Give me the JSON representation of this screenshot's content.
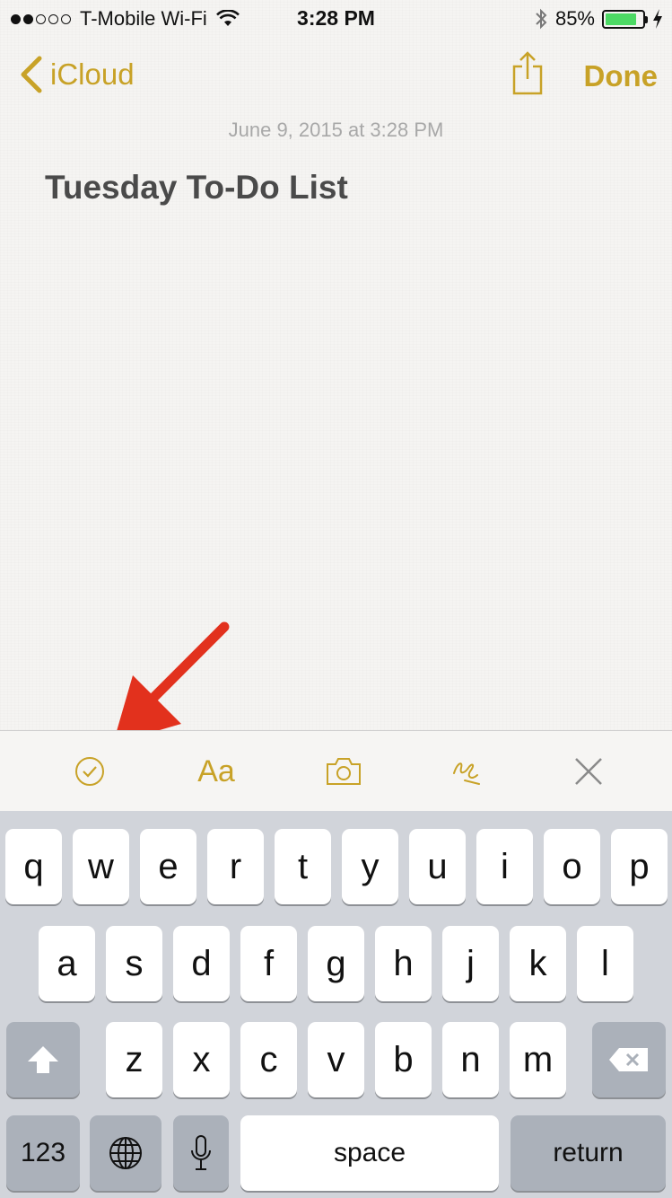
{
  "status_bar": {
    "signal_dots": [
      true,
      true,
      false,
      false,
      false
    ],
    "carrier": "T-Mobile Wi-Fi",
    "time": "3:28 PM",
    "battery_percent": "85%",
    "battery_level": 0.85
  },
  "nav": {
    "back_label": "iCloud",
    "done_label": "Done"
  },
  "note": {
    "date": "June 9, 2015 at 3:28 PM",
    "title": "Tuesday To-Do List"
  },
  "toolbar": {
    "format_label": "Aa",
    "icons": [
      "checklist-icon",
      "format-icon",
      "camera-icon",
      "sketch-icon",
      "close-icon"
    ]
  },
  "keyboard": {
    "row1": [
      "q",
      "w",
      "e",
      "r",
      "t",
      "y",
      "u",
      "i",
      "o",
      "p"
    ],
    "row2": [
      "a",
      "s",
      "d",
      "f",
      "g",
      "h",
      "j",
      "k",
      "l"
    ],
    "row3": [
      "z",
      "x",
      "c",
      "v",
      "b",
      "n",
      "m"
    ],
    "numbers_label": "123",
    "space_label": "space",
    "return_label": "return"
  },
  "colors": {
    "accent": "#c8a227",
    "annotation_arrow": "#e2311d",
    "battery": "#4cd964"
  }
}
